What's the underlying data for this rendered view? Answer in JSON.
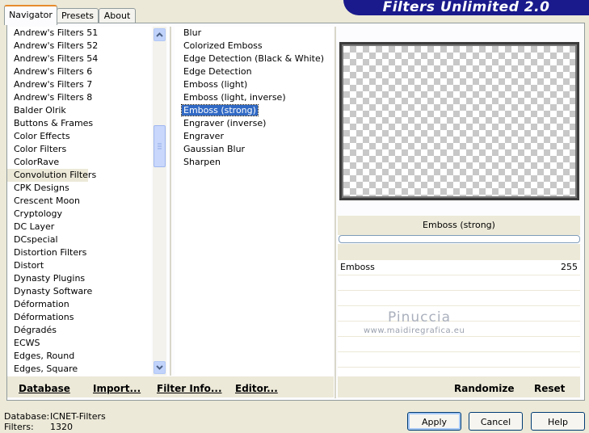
{
  "title": "Filters Unlimited 2.0",
  "tabs": [
    {
      "label": "Navigator",
      "active": true
    },
    {
      "label": "Presets",
      "active": false
    },
    {
      "label": "About",
      "active": false
    }
  ],
  "categories": [
    "Andrew's Filters 51",
    "Andrew's Filters 52",
    "Andrew's Filters 54",
    "Andrew's Filters 6",
    "Andrew's Filters 7",
    "Andrew's Filters 8",
    "Balder Olrik",
    "Buttons & Frames",
    "Color Effects",
    "Color Filters",
    "ColorRave",
    "Convolution Filters",
    "CPK Designs",
    "Crescent Moon",
    "Cryptology",
    "DC Layer",
    "DCspecial",
    "Distortion Filters",
    "Distort",
    "Dynasty Plugins",
    "Dynasty Software",
    "Déformation",
    "Déformations",
    "Dégradés",
    "ECWS",
    "Edges, Round",
    "Edges, Square"
  ],
  "selected_category": "Convolution Filters",
  "filters": [
    "Blur",
    "Colorized Emboss",
    "Edge Detection (Black & White)",
    "Edge Detection",
    "Emboss (light)",
    "Emboss (light, inverse)",
    "Emboss (strong)",
    "Engraver (inverse)",
    "Engraver",
    "Gaussian Blur",
    "Sharpen"
  ],
  "selected_filter": "Emboss (strong)",
  "preview": {
    "filter_name": "Emboss (strong)"
  },
  "parameters": [
    {
      "label": "Emboss",
      "value": "255"
    }
  ],
  "watermark": {
    "name": "Pinuccia",
    "url": "www.maidiregrafica.eu"
  },
  "toolbar": {
    "database": "Database",
    "import": "Import...",
    "filter_info": "Filter Info...",
    "editor": "Editor...",
    "randomize": "Randomize",
    "reset": "Reset"
  },
  "status": {
    "database_label": "Database:",
    "database_value": "ICNET-Filters",
    "filters_label": "Filters:",
    "filters_value": "1320"
  },
  "buttons": {
    "apply": "Apply",
    "cancel": "Cancel",
    "help": "Help"
  },
  "colors": {
    "banner": "#1a1a8c",
    "selection": "#316ac5"
  }
}
